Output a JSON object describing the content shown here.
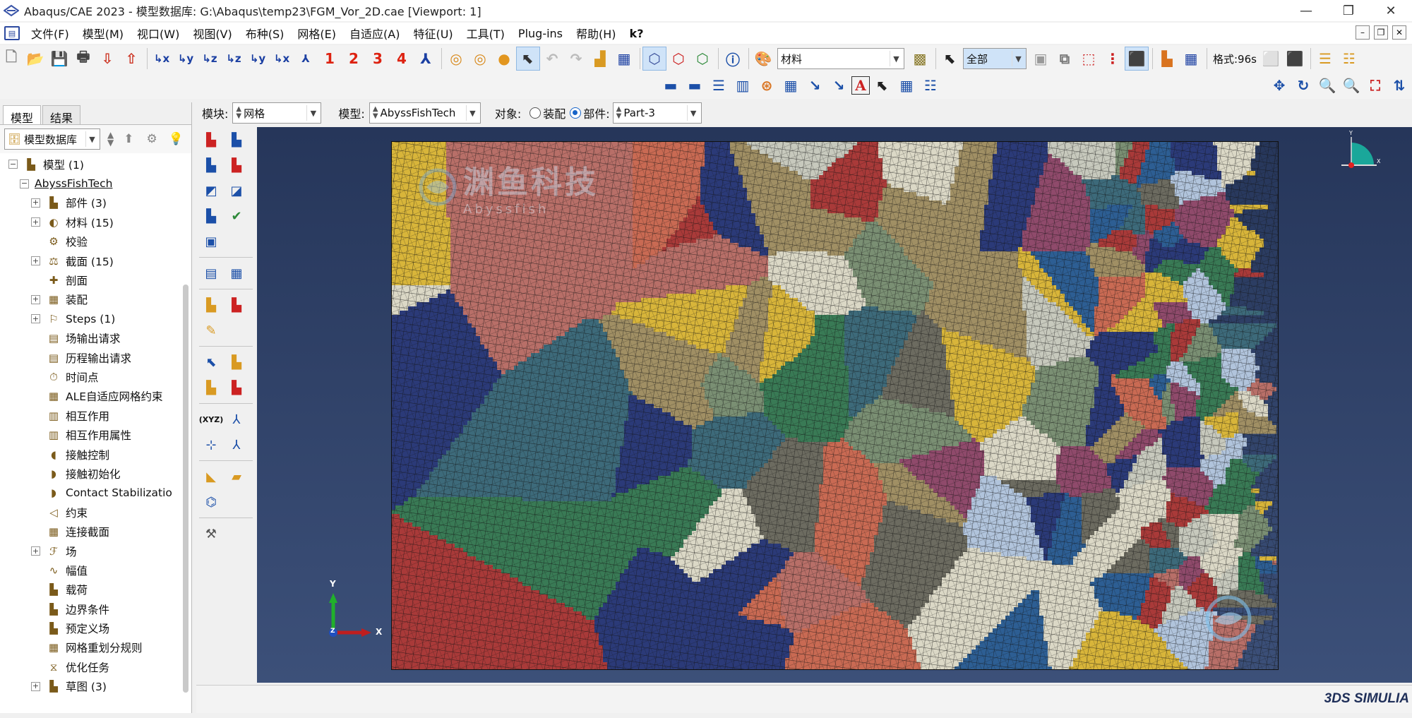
{
  "window": {
    "title": "Abaqus/CAE 2023 - 模型数据库: G:\\Abaqus\\temp23\\FGM_Vor_2D.cae [Viewport: 1]"
  },
  "menu": [
    "文件(F)",
    "模型(M)",
    "视口(W)",
    "视图(V)",
    "布种(S)",
    "网格(E)",
    "自适应(A)",
    "特征(U)",
    "工具(T)",
    "Plug-ins",
    "帮助(H)",
    "k?"
  ],
  "toolbar": {
    "material_combo": "材料",
    "selection_combo": "全部",
    "format_label": "格式:96s",
    "nums": [
      "1",
      "2",
      "3",
      "4"
    ]
  },
  "module_row": {
    "module_label": "模块:",
    "module_value": "网格",
    "model_label": "模型:",
    "model_value": "AbyssFishTech",
    "object_label": "对象:",
    "assembly_label": "装配",
    "part_label": "部件:",
    "part_value": "Part-3"
  },
  "tabs": [
    "模型",
    "结果"
  ],
  "tree": {
    "db_combo": "模型数据库",
    "items": [
      {
        "label": "模型 (1)",
        "indent": 0,
        "exp": "-"
      },
      {
        "label": "AbyssFishTech",
        "indent": 1,
        "exp": "-"
      },
      {
        "label": "部件 (3)",
        "indent": 2,
        "exp": "+"
      },
      {
        "label": "材料 (15)",
        "indent": 2,
        "exp": "+"
      },
      {
        "label": "校验",
        "indent": 2,
        "exp": ""
      },
      {
        "label": "截面 (15)",
        "indent": 2,
        "exp": "+"
      },
      {
        "label": "剖面",
        "indent": 2,
        "exp": ""
      },
      {
        "label": "装配",
        "indent": 2,
        "exp": "+"
      },
      {
        "label": "Steps (1)",
        "indent": 2,
        "exp": "+"
      },
      {
        "label": "场输出请求",
        "indent": 2,
        "exp": ""
      },
      {
        "label": "历程输出请求",
        "indent": 2,
        "exp": ""
      },
      {
        "label": "时间点",
        "indent": 2,
        "exp": ""
      },
      {
        "label": "ALE自适应网格约束",
        "indent": 2,
        "exp": ""
      },
      {
        "label": "相互作用",
        "indent": 2,
        "exp": ""
      },
      {
        "label": "相互作用属性",
        "indent": 2,
        "exp": ""
      },
      {
        "label": "接触控制",
        "indent": 2,
        "exp": ""
      },
      {
        "label": "接触初始化",
        "indent": 2,
        "exp": ""
      },
      {
        "label": "Contact Stabilizatio",
        "indent": 2,
        "exp": ""
      },
      {
        "label": "约束",
        "indent": 2,
        "exp": ""
      },
      {
        "label": "连接截面",
        "indent": 2,
        "exp": ""
      },
      {
        "label": "场",
        "indent": 2,
        "exp": "+"
      },
      {
        "label": "幅值",
        "indent": 2,
        "exp": ""
      },
      {
        "label": "载荷",
        "indent": 2,
        "exp": ""
      },
      {
        "label": "边界条件",
        "indent": 2,
        "exp": ""
      },
      {
        "label": "预定义场",
        "indent": 2,
        "exp": ""
      },
      {
        "label": "网格重划分规则",
        "indent": 2,
        "exp": ""
      },
      {
        "label": "优化任务",
        "indent": 2,
        "exp": ""
      },
      {
        "label": "草图 (3)",
        "indent": 2,
        "exp": "+"
      }
    ]
  },
  "viewport": {
    "triad": {
      "x": "X",
      "y": "Y",
      "z": "Z"
    },
    "watermark_main": "渊鱼科技",
    "watermark_sub": "Abyssfish"
  },
  "brand": "3DS SIMULIA",
  "colors": {
    "grain_palette": [
      "#b1c4dc",
      "#a93a39",
      "#2d5e93",
      "#c96a53",
      "#dbd8c6",
      "#6c6b60",
      "#397a55",
      "#d8b53a",
      "#8f4a6b",
      "#c7c9bd",
      "#2b3a78",
      "#b86f68",
      "#7a8f73",
      "#a08f64",
      "#3d6a7a"
    ],
    "mesh_line": "#1a1a1a",
    "viewport_top": "#26365a",
    "viewport_bottom": "#3c5079"
  }
}
